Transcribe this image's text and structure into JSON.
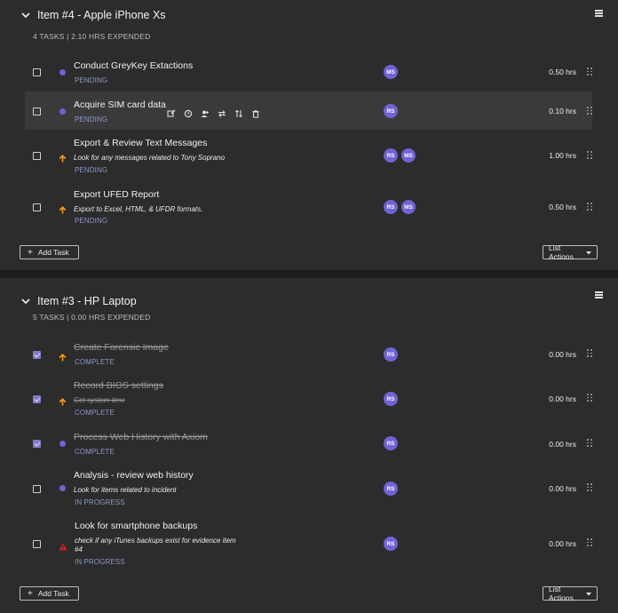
{
  "lists": [
    {
      "title": "Item #4 - Apple iPhone Xs",
      "summary": "4 TASKS | 2.10 HRS EXPENDED",
      "add_task_label": "Add Task",
      "list_actions_label": "List Actions",
      "tasks": [
        {
          "name": "Conduct GreyKey Extactions",
          "desc": "",
          "status": "PENDING",
          "assignees": [
            "MS"
          ],
          "hours": "0.50 hrs",
          "checked": false,
          "priority": "normal"
        },
        {
          "name": "Acquire SIM card data",
          "desc": "",
          "status": "PENDING",
          "assignees": [
            "RS"
          ],
          "hours": "0.10 hrs",
          "checked": false,
          "priority": "normal"
        },
        {
          "name": "Export & Review Text Messages",
          "desc": "Look for any messages related to Tony Soprano",
          "status": "PENDING",
          "assignees": [
            "RS",
            "MS"
          ],
          "hours": "1.00 hrs",
          "checked": false,
          "priority": "high"
        },
        {
          "name": "Export UFED Report",
          "desc": "Export to Excel, HTML, & UFDR formats.",
          "status": "PENDING",
          "assignees": [
            "RS",
            "MS"
          ],
          "hours": "0.50 hrs",
          "checked": false,
          "priority": "high"
        }
      ]
    },
    {
      "title": "Item #3 - HP Laptop",
      "summary": "5 TASKS | 0.00 HRS EXPENDED",
      "add_task_label": "Add Task",
      "list_actions_label": "List Actions",
      "tasks": [
        {
          "name": "Create Forensic Image",
          "desc": "",
          "status": "COMPLETE",
          "assignees": [
            "RS"
          ],
          "hours": "0.00 hrs",
          "checked": true,
          "priority": "high"
        },
        {
          "name": "Record BIOS settings",
          "desc": "Get system time",
          "status": "COMPLETE",
          "assignees": [
            "RS"
          ],
          "hours": "0.00 hrs",
          "checked": true,
          "priority": "high"
        },
        {
          "name": "Process Web History with Axiom",
          "desc": "",
          "status": "COMPLETE",
          "assignees": [
            "RS"
          ],
          "hours": "0.00 hrs",
          "checked": true,
          "priority": "normal"
        },
        {
          "name": "Analysis - review web history",
          "desc": "Look for items related to incident",
          "status": "IN PROGRESS",
          "assignees": [
            "RS"
          ],
          "hours": "0.00 hrs",
          "checked": false,
          "priority": "normal"
        },
        {
          "name": "Look for smartphone backups",
          "desc": "check if any iTunes backups exist for evidence item",
          "desc2": "#4",
          "status": "IN PROGRESS",
          "assignees": [
            "RS"
          ],
          "hours": "0.00 hrs",
          "checked": false,
          "priority": "urgent"
        }
      ]
    }
  ],
  "colors": {
    "accent": "#6e64d6",
    "high": "#f0a020",
    "urgent": "#d42020",
    "status": "#8e98c7"
  }
}
